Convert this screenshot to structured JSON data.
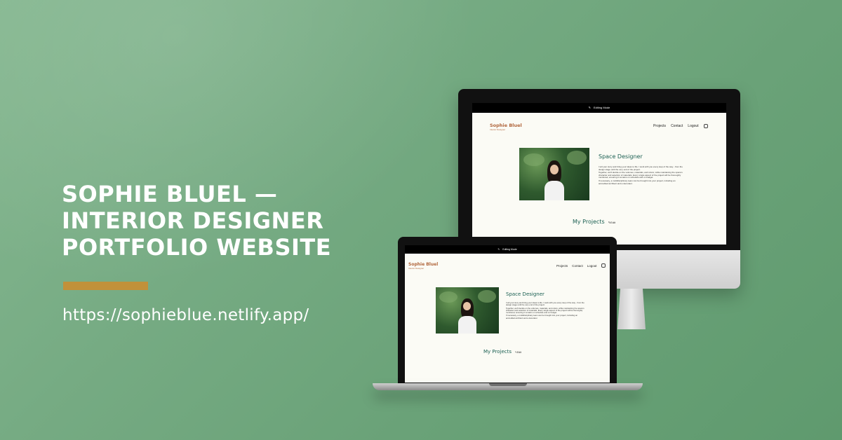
{
  "banner": {
    "headline_lines": [
      " SOPHIE BLUEL —",
      "INTERIOR DESIGNER",
      "PORTFOLIO WEBSITE"
    ],
    "url": "https://sophieblue.netlify.app/",
    "accent_color": "#c1913a",
    "background_color": "#76ab83"
  },
  "site": {
    "edit_mode_label": "Editing Mode",
    "brand_name": "Sophie Bluel",
    "brand_subtitle": "Interior Designer",
    "nav": [
      "Projects",
      "Contact",
      "Logout"
    ],
    "instagram_icon": "instagram-icon",
    "intro_title": "Space Designer",
    "intro_paragraphs": [
      "I tell your story and bring your ideas to life. I work with you every step of the way - from the design stage until the very end of the project.",
      "Together, we'll decide on the volumes, materials, and colors, while maintaining the space's character and selection of materials. Every single aspect of the project will be thoroughly monitored, ensuring it remains on schedule and on budget.",
      "If necessary, a multidisciplinary team can be brought into your project, including an accredited architect and a decorator."
    ],
    "projects_title": "My Projects",
    "edit_label": "Edit",
    "brand_color": "#b1663c",
    "title_color": "#1d6154"
  }
}
